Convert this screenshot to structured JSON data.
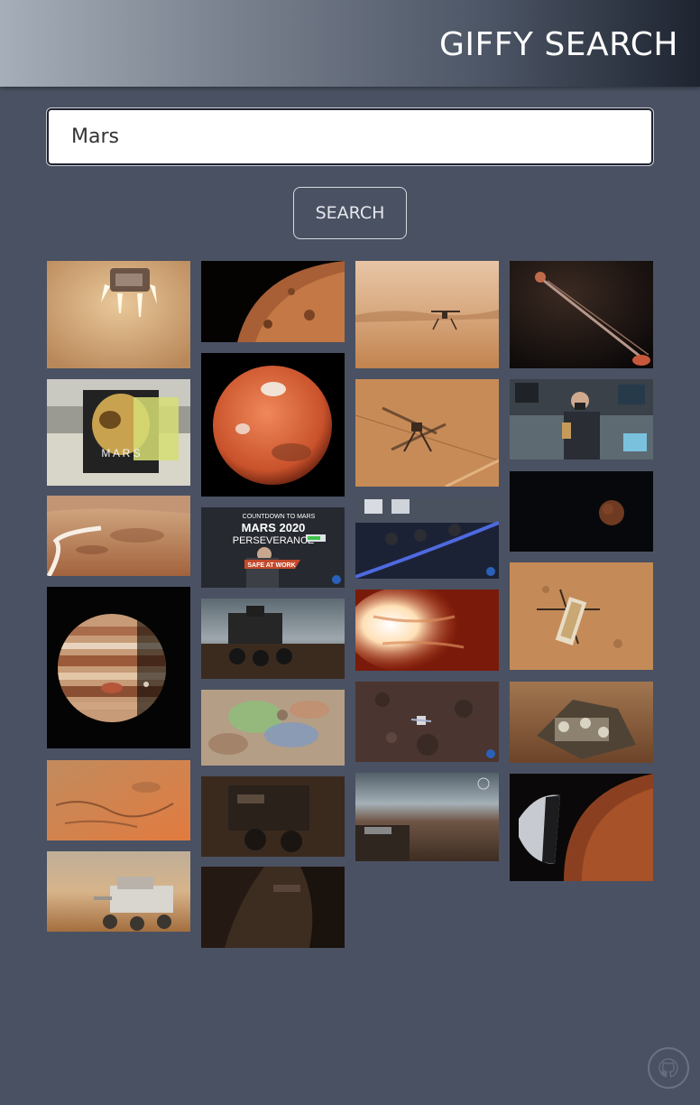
{
  "header": {
    "title": "GIFFY SEARCH"
  },
  "search": {
    "value": "Mars",
    "button_label": "SEARCH"
  },
  "results": [
    {
      "name": "gif-lander-descent-engines",
      "alt": "lander descent engines"
    },
    {
      "name": "gif-mars-surface-orbit",
      "alt": "mars surface orbit"
    },
    {
      "name": "gif-helicopter-desert",
      "alt": "helicopter desert"
    },
    {
      "name": "gif-parachute-deploy",
      "alt": "parachute deploy"
    },
    {
      "name": "gif-mars-book",
      "alt": "mars book"
    },
    {
      "name": "gif-mars-globe",
      "alt": "mars globe"
    },
    {
      "name": "gif-helicopter-shadow",
      "alt": "helicopter shadow"
    },
    {
      "name": "gif-mission-control-man",
      "alt": "mission control man"
    },
    {
      "name": "gif-rover-tracks",
      "alt": "rover tracks"
    },
    {
      "name": "gif-countdown-perseverance",
      "alt": "countdown perseverance"
    },
    {
      "name": "gif-control-room",
      "alt": "control room"
    },
    {
      "name": "gif-small-mars-dark",
      "alt": "small mars dark"
    },
    {
      "name": "gif-jupiter",
      "alt": "jupiter"
    },
    {
      "name": "gif-rover-night",
      "alt": "rover night"
    },
    {
      "name": "gif-heatshield-entry",
      "alt": "heatshield entry"
    },
    {
      "name": "gif-helicopter-topdown",
      "alt": "helicopter topdown"
    },
    {
      "name": "gif-crater-aerial",
      "alt": "crater aerial"
    },
    {
      "name": "gif-colored-terrain",
      "alt": "colored terrain"
    },
    {
      "name": "gif-orbiter-craters",
      "alt": "orbiter craters"
    },
    {
      "name": "gif-skycrane-lander",
      "alt": "skycrane lander"
    },
    {
      "name": "gif-rover-sunny",
      "alt": "rover sunny"
    },
    {
      "name": "gif-rover-closeup",
      "alt": "rover closeup"
    },
    {
      "name": "gif-rover-horizon",
      "alt": "rover horizon"
    },
    {
      "name": "gif-capsule-entry",
      "alt": "capsule entry"
    },
    {
      "name": "gif-rover-dark-arm",
      "alt": "rover dark arm"
    }
  ],
  "countdown_overlay": {
    "line1": "COUNTDOWN TO MARS",
    "line2": "MARS 2020",
    "line3": "PERSEVERANCE",
    "badge": "SAFE AT WORK"
  },
  "book_overlay": {
    "text": "M A R S"
  },
  "footer": {
    "icon": "github-icon"
  }
}
